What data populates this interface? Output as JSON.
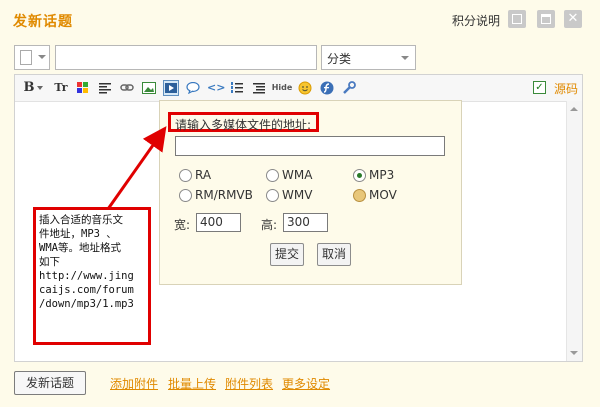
{
  "header": {
    "title": "发新话题",
    "points_label": "积分说明"
  },
  "composer": {
    "category_value": "分类",
    "subject_value": ""
  },
  "toolbar": {
    "items": [
      "bold-icon",
      "font-size-icon",
      "color-icon",
      "align-icon",
      "link-icon",
      "image-icon",
      "media-icon",
      "quote-icon",
      "code-icon",
      "ordered-list-icon",
      "unordered-list-icon",
      "hide-icon",
      "smiley-icon",
      "flash-icon",
      "tools-icon"
    ],
    "bold_label": "B",
    "size_label": "Tr",
    "hide_label": "Hide",
    "source_label": "源码",
    "source_checked": true
  },
  "media_dialog": {
    "prompt": "请输入多媒体文件的地址:",
    "url_value": "",
    "formats": [
      {
        "label": "RA",
        "selected": false
      },
      {
        "label": "WMA",
        "selected": false
      },
      {
        "label": "MP3",
        "selected": true
      },
      {
        "label": "RM/RMVB",
        "selected": false
      },
      {
        "label": "WMV",
        "selected": false
      },
      {
        "label": "MOV",
        "selected": false
      }
    ],
    "width_label": "宽:",
    "width_value": "400",
    "height_label": "高:",
    "height_value": "300",
    "submit_label": "提交",
    "cancel_label": "取消"
  },
  "annotation": {
    "lines": [
      "插入合适的音乐文",
      "件地址，MP3 、",
      "WMA等。地址格式",
      "如下",
      "http://www.jing",
      "caijs.com/forum",
      "/down/mp3/1.mp3"
    ],
    "color": "#e00000"
  },
  "footer": {
    "post_button": "发新话题",
    "links": [
      "添加附件",
      "批量上传",
      "附件列表",
      "更多设定"
    ]
  },
  "colors": {
    "accent": "#e08a00",
    "background": "#fefbea",
    "annotation": "#e00000"
  }
}
